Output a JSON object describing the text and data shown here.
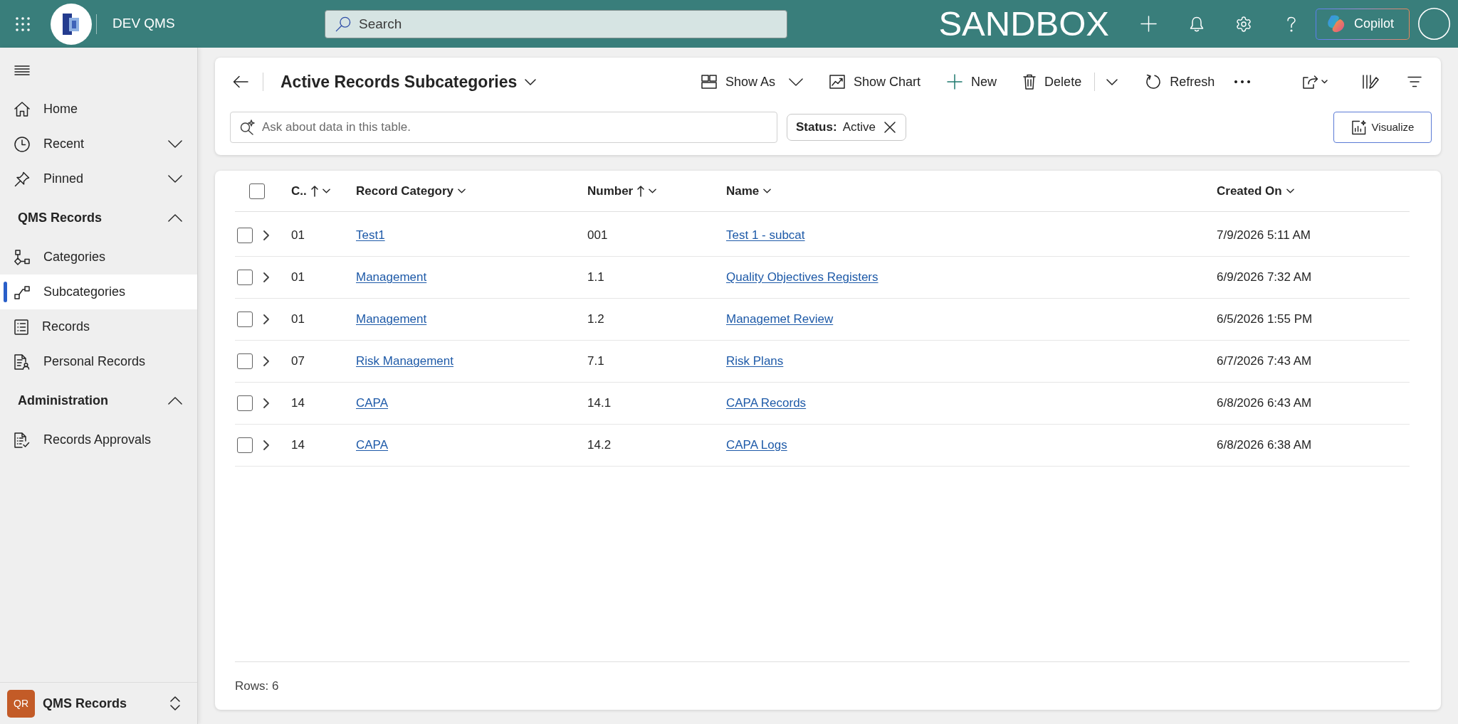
{
  "top_bar": {
    "app_name": "DEV QMS",
    "search": {
      "placeholder": "Search"
    },
    "environment": "SANDBOX",
    "copilot_button": "Copilot"
  },
  "sidebar": {
    "items": [
      {
        "label": "Home",
        "selected": false
      },
      {
        "label": "Recent",
        "selected": false,
        "expanded": false
      },
      {
        "label": "Pinned",
        "selected": false,
        "expanded": false
      }
    ],
    "groups": [
      {
        "title": "QMS Records",
        "expanded": true,
        "items": [
          {
            "label": "Categories",
            "selected": false
          },
          {
            "label": "Subcategories",
            "selected": true
          },
          {
            "label": "Records",
            "selected": false
          },
          {
            "label": "Personal Records",
            "selected": false
          }
        ]
      },
      {
        "title": "Administration",
        "expanded": true,
        "items": [
          {
            "label": "Records Approvals",
            "selected": false
          }
        ]
      }
    ],
    "area_switcher": {
      "badge": "QR",
      "label": "QMS Records"
    }
  },
  "command_bar": {
    "title": "Active Records Subcategories",
    "commands": [
      {
        "label": "Show As",
        "kind": "menu"
      },
      {
        "label": "Show Chart",
        "kind": "button"
      },
      {
        "label": "New",
        "kind": "button"
      },
      {
        "label": "Delete",
        "kind": "split"
      },
      {
        "label": "Refresh",
        "kind": "button"
      }
    ],
    "ask": {
      "placeholder": "Ask about data in this table."
    },
    "filter_chip": {
      "field": "Status:",
      "value": "Active"
    },
    "visualize_button": "Visualize"
  },
  "grid": {
    "select_all": false,
    "columns": [
      {
        "label": "C..",
        "kind": "text",
        "sorted": true
      },
      {
        "label": "Record Category",
        "kind": "link",
        "sorted": false
      },
      {
        "label": "Number",
        "kind": "text",
        "sorted": true
      },
      {
        "label": "Name",
        "kind": "link",
        "sorted": false
      },
      {
        "label": "Created On",
        "kind": "text",
        "sorted": false
      }
    ],
    "rows": [
      {
        "selected": false,
        "expanded": false,
        "cells": [
          "01",
          "Test1",
          "001",
          "Test 1 - subcat",
          "7/9/2026 5:11 AM"
        ]
      },
      {
        "selected": false,
        "expanded": false,
        "cells": [
          "01",
          "Management",
          "1.1",
          "Quality Objectives Registers",
          "6/9/2026 7:32 AM"
        ]
      },
      {
        "selected": false,
        "expanded": false,
        "cells": [
          "01",
          "Management",
          "1.2",
          "Managemet Review",
          "6/5/2026 1:55 PM"
        ]
      },
      {
        "selected": false,
        "expanded": false,
        "cells": [
          "07",
          "Risk Management",
          "7.1",
          "Risk Plans",
          "6/7/2026 7:43 AM"
        ]
      },
      {
        "selected": false,
        "expanded": false,
        "cells": [
          "14",
          "CAPA",
          "14.1",
          "CAPA Records",
          "6/8/2026 6:43 AM"
        ]
      },
      {
        "selected": false,
        "expanded": false,
        "cells": [
          "14",
          "CAPA",
          "14.2",
          "CAPA Logs",
          "6/8/2026 6:38 AM"
        ]
      }
    ],
    "footer": "Rows: 6"
  }
}
